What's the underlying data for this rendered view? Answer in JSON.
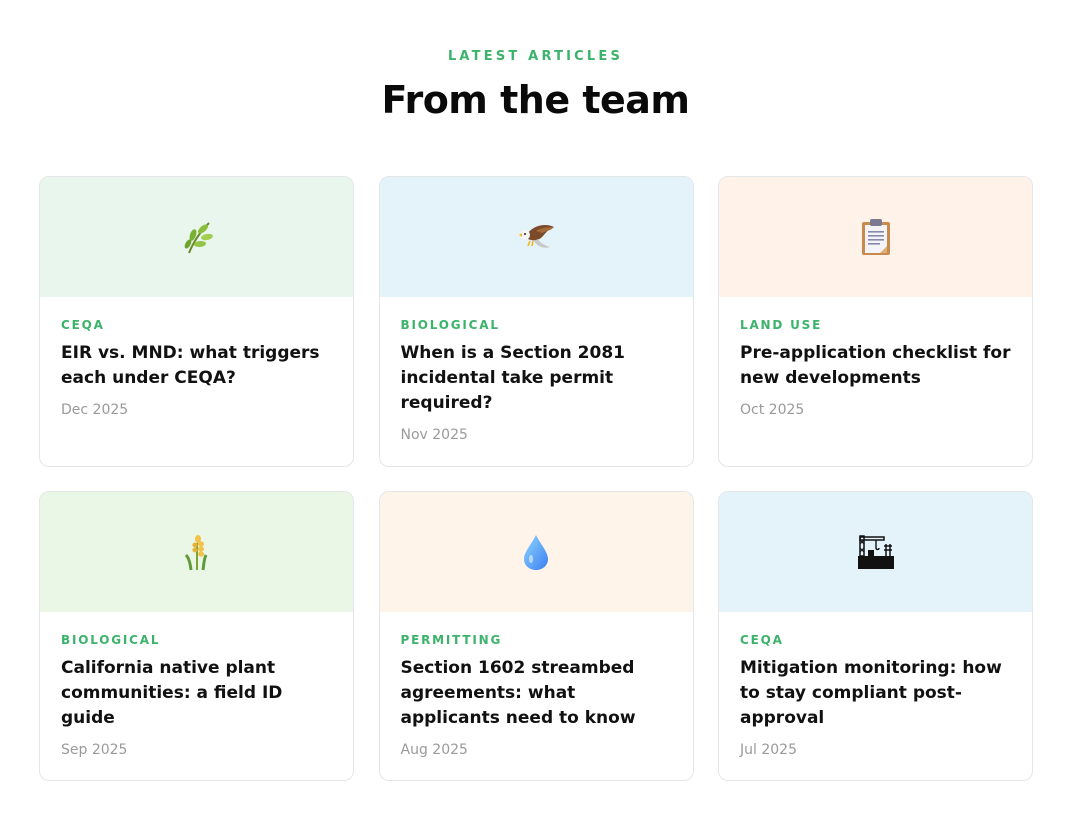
{
  "section": {
    "eyebrow": "LATEST ARTICLES",
    "title": "From the team"
  },
  "articles": [
    {
      "tag": "CEQA",
      "title": "EIR vs. MND: what triggers each under CEQA?",
      "date": "Dec 2025",
      "icon": "herb-icon",
      "thumb_color": "#e8f6ee"
    },
    {
      "tag": "BIOLOGICAL",
      "title": "When is a Section 2081 incidental take permit required?",
      "date": "Nov 2025",
      "icon": "eagle-icon",
      "thumb_color": "#e4f3fa"
    },
    {
      "tag": "LAND USE",
      "title": "Pre-application checklist for new developments",
      "date": "Oct 2025",
      "icon": "clipboard-icon",
      "thumb_color": "#fff2e8"
    },
    {
      "tag": "BIOLOGICAL",
      "title": "California native plant communities: a field ID guide",
      "date": "Sep 2025",
      "icon": "sheaf-of-rice-icon",
      "thumb_color": "#ebf7e6"
    },
    {
      "tag": "PERMITTING",
      "title": "Section 1602 streambed agreements: what applicants need to know",
      "date": "Aug 2025",
      "icon": "droplet-icon",
      "thumb_color": "#fff4ea"
    },
    {
      "tag": "CEQA",
      "title": "Mitigation monitoring: how to stay compliant post-approval",
      "date": "Jul 2025",
      "icon": "construction-site-icon",
      "thumb_color": "#e4f3fa"
    }
  ],
  "colors": {
    "accent": "#3bb36a",
    "date_gray": "#9a9a9a"
  }
}
